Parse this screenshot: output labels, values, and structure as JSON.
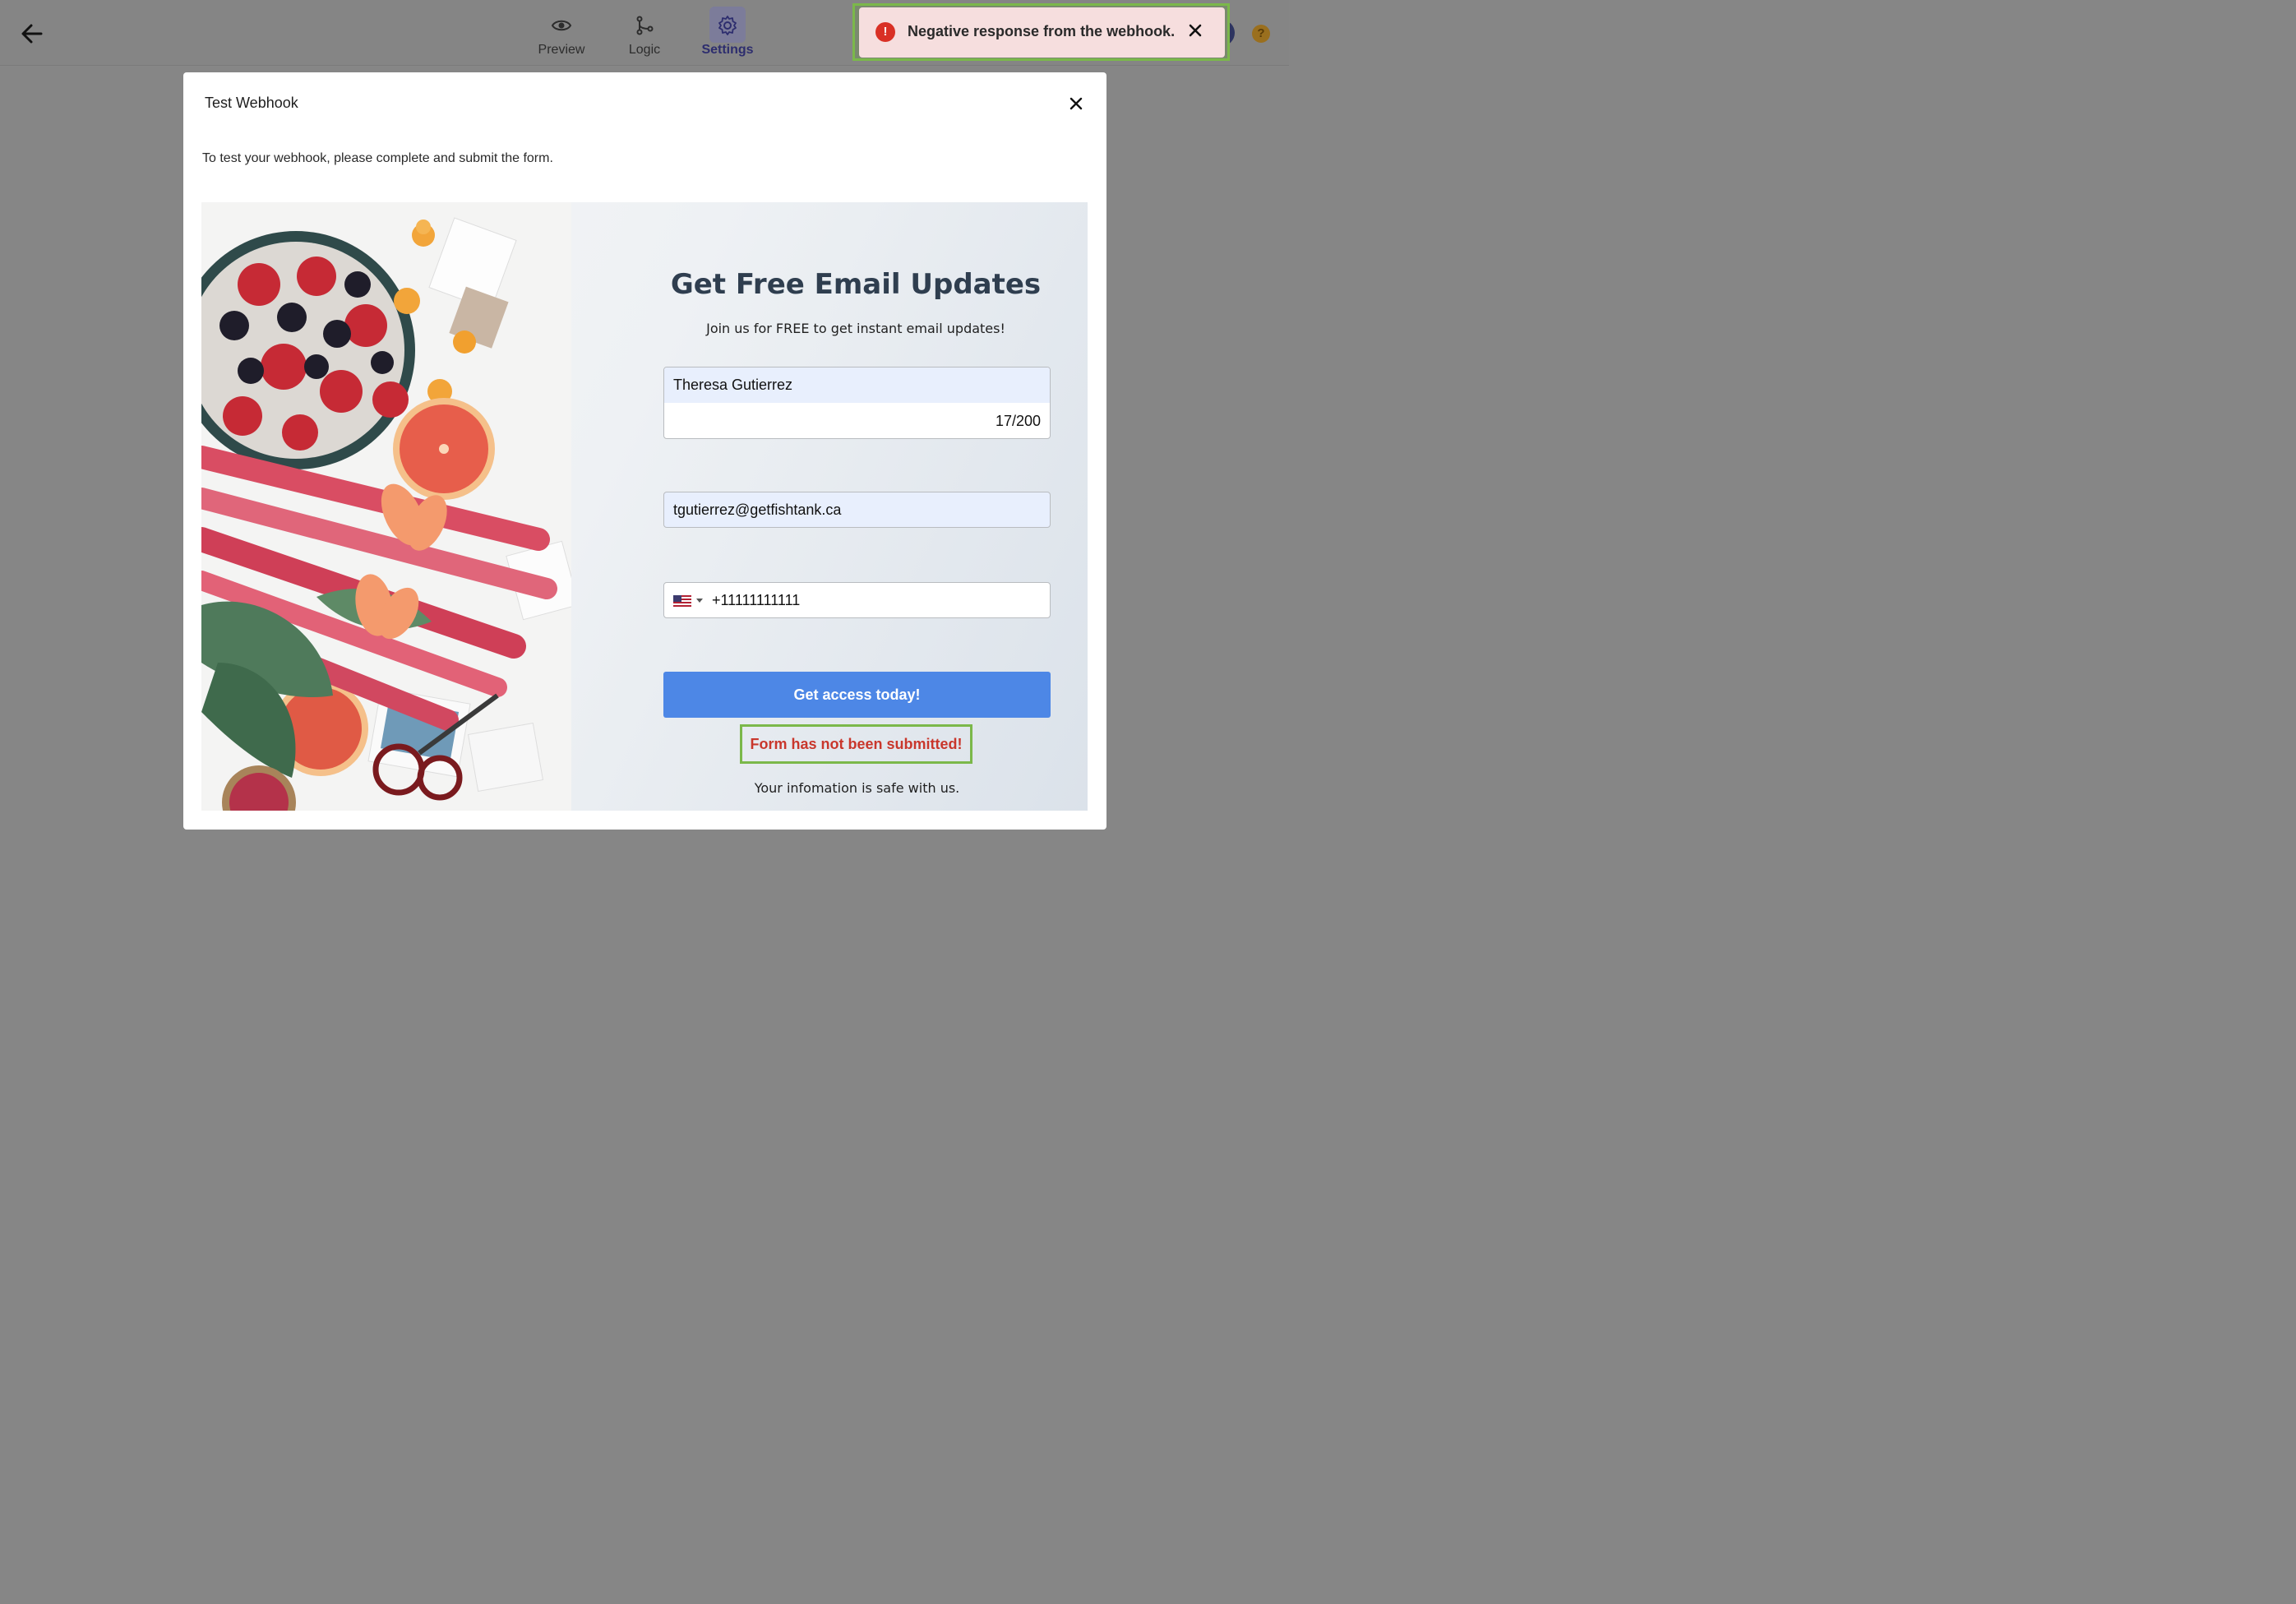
{
  "header": {
    "tabs": [
      {
        "label": "Preview",
        "icon": "eye-icon"
      },
      {
        "label": "Logic",
        "icon": "branch-icon"
      },
      {
        "label": "Settings",
        "icon": "gear-icon",
        "active": true
      }
    ],
    "help_label": "?"
  },
  "toast": {
    "message": "Negative response from the webhook.",
    "type": "error",
    "icon_glyph": "!",
    "color": "#d93025"
  },
  "modal": {
    "title": "Test Webhook",
    "description": "To test your webhook, please complete and submit the form."
  },
  "form": {
    "title": "Get Free Email Updates",
    "subtitle": "Join us for FREE to get instant email updates!",
    "name_value": "Theresa Gutierrez",
    "name_counter": "17/200",
    "email_value": "tgutierrez@getfishtank.ca",
    "phone_country": "US",
    "phone_value": "+11111111111",
    "submit_label": "Get access today!",
    "error_message": "Form has not been submitted!",
    "safe_note": "Your infomation is safe with us.",
    "accent_color": "#4d87e6"
  }
}
